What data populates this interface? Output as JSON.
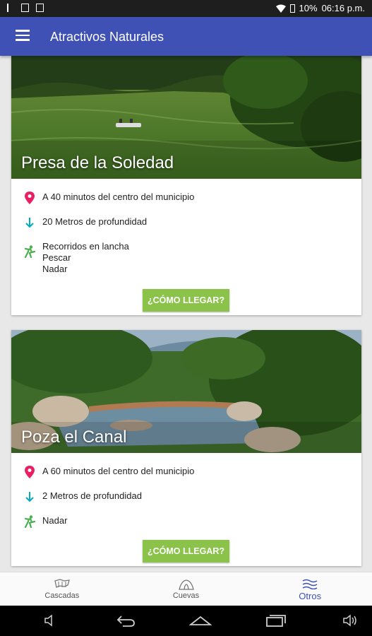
{
  "status_bar": {
    "battery": "10%",
    "time": "06:16 p.m."
  },
  "app_bar": {
    "title": "Atractivos Naturales",
    "menu_icon": "hamburger-menu-icon"
  },
  "places": [
    {
      "name": "Presa de la Soledad",
      "distance": "A 40 minutos del centro del municipio",
      "depth": "20 Metros de profundidad",
      "activities": [
        "Recorridos en lancha",
        "Pescar",
        "Nadar"
      ],
      "button": "¿CÓMO LLEGAR?"
    },
    {
      "name": "Poza el Canal",
      "distance": "A 60 minutos del centro del municipio",
      "depth": "2 Metros de profundidad",
      "activities": [
        "Nadar"
      ],
      "button": "¿CÓMO LLEGAR?"
    }
  ],
  "bottom_nav": [
    {
      "label": "Cascadas",
      "icon": "waterfall-icon",
      "active": false
    },
    {
      "label": "Cuevas",
      "icon": "cave-icon",
      "active": false
    },
    {
      "label": "Otros",
      "icon": "river-icon",
      "active": true
    }
  ],
  "colors": {
    "primary": "#3f51b5",
    "button": "#8bc34a",
    "location_pin": "#e91e63",
    "depth_arrow": "#00acc1",
    "activity_icon": "#4caf50"
  }
}
